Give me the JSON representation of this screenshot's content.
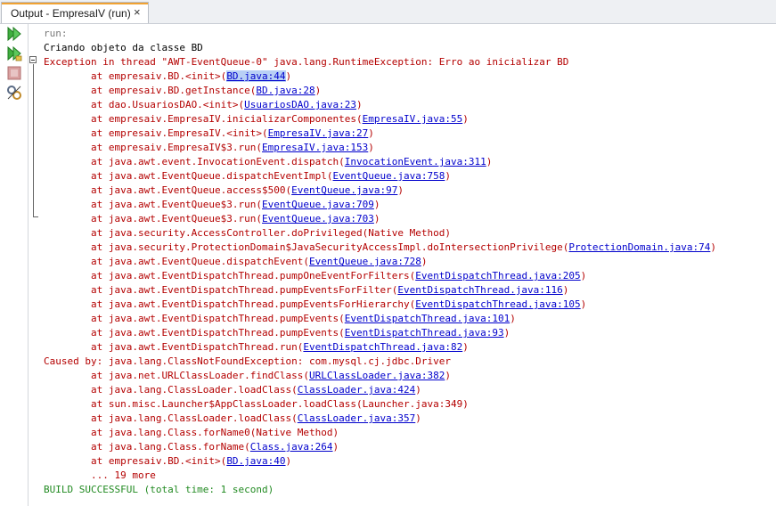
{
  "tab": {
    "title": "Output - EmpresaIV (run)",
    "close_glyph": "×",
    "accent": "#f0a232"
  },
  "toolbar": {
    "items": [
      {
        "name": "rerun-icon"
      },
      {
        "name": "rerun-with-args-icon"
      },
      {
        "name": "stop-icon"
      },
      {
        "name": "settings-icon"
      }
    ]
  },
  "colors": {
    "error": "#b40000",
    "link": "#0000cc",
    "success": "#218a21",
    "muted": "#7a7a7a",
    "selection": "#b8cff5"
  },
  "lines": [
    {
      "t": "muted",
      "pre": "run:"
    },
    {
      "t": "plain",
      "pre": "Criando objeto da classe BD"
    },
    {
      "t": "red",
      "pre": "Exception in thread \"AWT-EventQueue-0\" java.lang.RuntimeException: Erro ao inicializar BD"
    },
    {
      "t": "red",
      "pre": "        at empresaiv.BD.<init>(",
      "link": "BD.java:44",
      "hl": true,
      "post": ")"
    },
    {
      "t": "red",
      "pre": "        at empresaiv.BD.getInstance(",
      "link": "BD.java:28",
      "post": ")"
    },
    {
      "t": "red",
      "pre": "        at dao.UsuariosDAO.<init>(",
      "link": "UsuariosDAO.java:23",
      "post": ")"
    },
    {
      "t": "red",
      "pre": "        at empresaiv.EmpresaIV.inicializarComponentes(",
      "link": "EmpresaIV.java:55",
      "post": ")"
    },
    {
      "t": "red",
      "pre": "        at empresaiv.EmpresaIV.<init>(",
      "link": "EmpresaIV.java:27",
      "post": ")"
    },
    {
      "t": "red",
      "pre": "        at empresaiv.EmpresaIV$3.run(",
      "link": "EmpresaIV.java:153",
      "post": ")"
    },
    {
      "t": "red",
      "pre": "        at java.awt.event.InvocationEvent.dispatch(",
      "link": "InvocationEvent.java:311",
      "post": ")"
    },
    {
      "t": "red",
      "pre": "        at java.awt.EventQueue.dispatchEventImpl(",
      "link": "EventQueue.java:758",
      "post": ")"
    },
    {
      "t": "red",
      "pre": "        at java.awt.EventQueue.access$500(",
      "link": "EventQueue.java:97",
      "post": ")"
    },
    {
      "t": "red",
      "pre": "        at java.awt.EventQueue$3.run(",
      "link": "EventQueue.java:709",
      "post": ")"
    },
    {
      "t": "red",
      "pre": "        at java.awt.EventQueue$3.run(",
      "link": "EventQueue.java:703",
      "post": ")"
    },
    {
      "t": "red",
      "pre": "        at java.security.AccessController.doPrivileged(Native Method)"
    },
    {
      "t": "red",
      "pre": "        at java.security.ProtectionDomain$JavaSecurityAccessImpl.doIntersectionPrivilege(",
      "link": "ProtectionDomain.java:74",
      "post": ")"
    },
    {
      "t": "red",
      "pre": "        at java.awt.EventQueue.dispatchEvent(",
      "link": "EventQueue.java:728",
      "post": ")"
    },
    {
      "t": "red",
      "pre": "        at java.awt.EventDispatchThread.pumpOneEventForFilters(",
      "link": "EventDispatchThread.java:205",
      "post": ")"
    },
    {
      "t": "red",
      "pre": "        at java.awt.EventDispatchThread.pumpEventsForFilter(",
      "link": "EventDispatchThread.java:116",
      "post": ")"
    },
    {
      "t": "red",
      "pre": "        at java.awt.EventDispatchThread.pumpEventsForHierarchy(",
      "link": "EventDispatchThread.java:105",
      "post": ")"
    },
    {
      "t": "red",
      "pre": "        at java.awt.EventDispatchThread.pumpEvents(",
      "link": "EventDispatchThread.java:101",
      "post": ")"
    },
    {
      "t": "red",
      "pre": "        at java.awt.EventDispatchThread.pumpEvents(",
      "link": "EventDispatchThread.java:93",
      "post": ")"
    },
    {
      "t": "red",
      "pre": "        at java.awt.EventDispatchThread.run(",
      "link": "EventDispatchThread.java:82",
      "post": ")"
    },
    {
      "t": "red",
      "pre": "Caused by: java.lang.ClassNotFoundException: com.mysql.cj.jdbc.Driver"
    },
    {
      "t": "red",
      "pre": "        at java.net.URLClassLoader.findClass(",
      "link": "URLClassLoader.java:382",
      "post": ")"
    },
    {
      "t": "red",
      "pre": "        at java.lang.ClassLoader.loadClass(",
      "link": "ClassLoader.java:424",
      "post": ")"
    },
    {
      "t": "red",
      "pre": "        at sun.misc.Launcher$AppClassLoader.loadClass(Launcher.java:349)"
    },
    {
      "t": "red",
      "pre": "        at java.lang.ClassLoader.loadClass(",
      "link": "ClassLoader.java:357",
      "post": ")"
    },
    {
      "t": "red",
      "pre": "        at java.lang.Class.forName0(Native Method)"
    },
    {
      "t": "red",
      "pre": "        at java.lang.Class.forName(",
      "link": "Class.java:264",
      "post": ")"
    },
    {
      "t": "red",
      "pre": "        at empresaiv.BD.<init>(",
      "link": "BD.java:40",
      "post": ")"
    },
    {
      "t": "red",
      "pre": "        ... 19 more"
    },
    {
      "t": "green",
      "pre": "BUILD SUCCESSFUL (total time: 1 second)"
    }
  ]
}
